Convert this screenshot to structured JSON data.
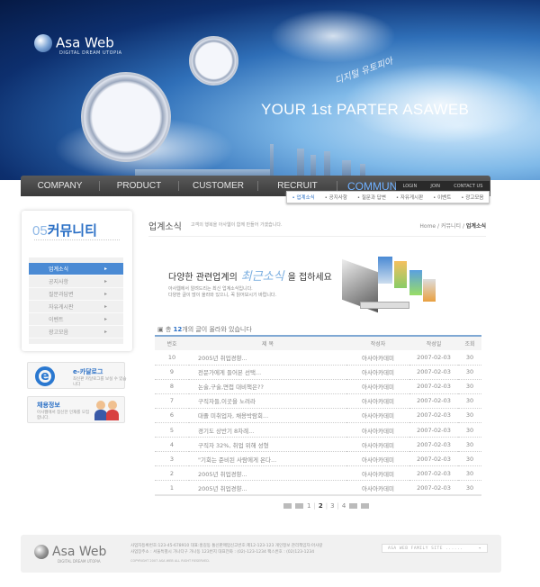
{
  "header": {
    "logo": "Asa Web",
    "logo_sub": "DIGITAL DREAM UTOPIA",
    "slogan": "YOUR 1st PARTER ASAWEB",
    "script_text": "디지털 유토피아"
  },
  "nav": {
    "items": [
      "COMPANY",
      "PRODUCT",
      "CUSTOMER",
      "RECRUIT",
      "COMMUNITY"
    ],
    "active": "COMMUNITY",
    "util": [
      "LOGIN",
      "JOIN",
      "CONTACT US"
    ],
    "submenu": [
      "• 업계소식",
      "• 공지사항",
      "• 질문과 답변",
      "• 자유게시판",
      "• 이벤트",
      "• 광고모음"
    ]
  },
  "sidebar": {
    "num": "05",
    "title": "커뮤니티",
    "items": [
      "업계소식",
      "공지사항",
      "질문과답변",
      "자유게시판",
      "이벤트",
      "광고모음"
    ],
    "arrow": "▸",
    "catalog": {
      "title": "e-카달로그",
      "desc": "최신판 카달로그를 보실 수 있습니다"
    },
    "recruit": {
      "title": "채용정보",
      "desc": "아사웹에서 참신한 인재를 모집합니다."
    }
  },
  "page": {
    "title": "업계소식",
    "desc": "고객의 행복을 아사웹이 함께 만들어 가겠습니다.",
    "crumb_home": "Home",
    "crumb_sep": " / ",
    "crumb_mid": "커뮤니티",
    "crumb_cur": "업계소식"
  },
  "promo": {
    "pre": "다양한 관련업계의",
    "highlight": "최근소식",
    "post": "을 접하세요",
    "line1": "아사웹에서 알려드리는 최신 업계소식입니다.",
    "line2": "다양한 글이 많이 올라와 있으니, 꼭 읽어보시기 바랍니다."
  },
  "list": {
    "count_pre": "총 ",
    "count": "12",
    "count_post": "개의 글이 올라와 있습니다",
    "headers": [
      "번호",
      "제 목",
      "작성자",
      "작성일",
      "조회"
    ],
    "rows": [
      [
        "10",
        "2005년 취업경향...",
        "아사아카데미",
        "2007-02-03",
        "30"
      ],
      [
        "9",
        "전문가에게 들어본 선택...",
        "아사아카데미",
        "2007-02-03",
        "30"
      ],
      [
        "8",
        "논술,구술,면접 대비책은??",
        "아사아카데미",
        "2007-02-03",
        "30"
      ],
      [
        "7",
        "구직자들,이곳을 노려라",
        "아사아카데미",
        "2007-02-03",
        "30"
      ],
      [
        "6",
        "대졸 미취업자, 채용박람회...",
        "아사아카데미",
        "2007-02-03",
        "30"
      ],
      [
        "5",
        "경기도 상반기 8차례...",
        "아사아카데미",
        "2007-02-03",
        "30"
      ],
      [
        "4",
        "구직자 32%, 취업 위해 성형",
        "아사아카데미",
        "2007-02-03",
        "30"
      ],
      [
        "3",
        "\"기회는 준비된 사람에게 온다...",
        "아사아카데미",
        "2007-02-03",
        "30"
      ],
      [
        "2",
        "2005년 취업경향...",
        "아사아카데미",
        "2007-02-03",
        "30"
      ],
      [
        "1",
        "2005년 취업경향...",
        "아사아카데미",
        "2007-02-03",
        "30"
      ]
    ]
  },
  "pager": {
    "pages": [
      "1",
      "2",
      "3",
      "4"
    ],
    "current": "2"
  },
  "footer": {
    "logo": "Asa Web",
    "logo_sub": "DIGITAL DREAM UTOPIA",
    "addr1": "사업자등록번호:123-45-678910 대표:홍길동 통신판매업신고번호:제12-123-123 개인정보 관리책임자:아사랑",
    "addr2": "사업장주소 : 서울특별시 가나다구 가나동 123번지 대표전화 : (02)-123-1234 팩스번호 : (02)123-1234",
    "copyright": "COPYRIGHT 2007 ASA WEB  ALL RIGHT RESERVED.",
    "family_site": "ASA WEB FAMILY SITE ......",
    "select_arrow": "▾"
  }
}
